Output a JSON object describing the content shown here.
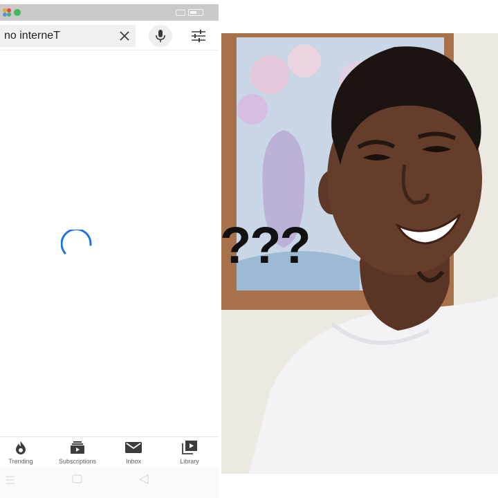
{
  "search": {
    "query": "no interneT"
  },
  "bottom_nav": {
    "items": [
      {
        "label": "Trending",
        "icon": "flame-icon"
      },
      {
        "label": "Subscriptions",
        "icon": "subscriptions-icon"
      },
      {
        "label": "Inbox",
        "icon": "inbox-icon"
      },
      {
        "label": "Library",
        "icon": "library-icon"
      }
    ]
  },
  "meme": {
    "caption": "???"
  },
  "colors": {
    "status_bar": "#c9c9c9",
    "spinner": "#1a73e8",
    "icon_dark": "#3c3c3c",
    "nav_label": "#606060"
  },
  "icons": {
    "clear": "close-icon",
    "mic": "microphone-icon",
    "filter": "filter-sliders-icon",
    "loading": "loading-spinner-icon",
    "system_nav": [
      "menu-lines-icon",
      "home-square-icon",
      "back-triangle-icon"
    ]
  }
}
